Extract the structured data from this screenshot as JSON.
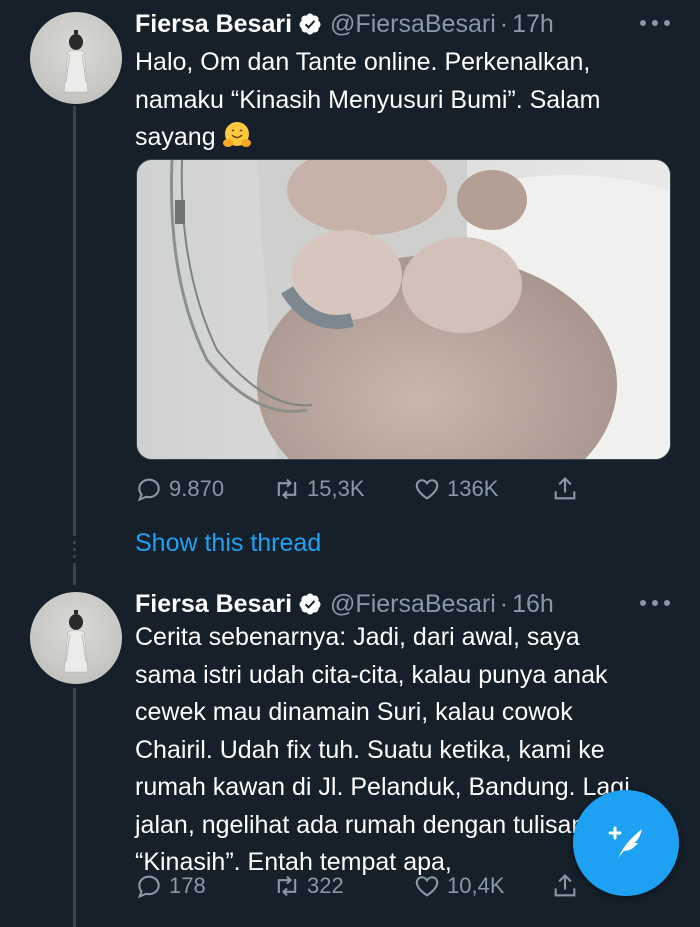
{
  "tweets": [
    {
      "author": "Fiersa Besari",
      "handle": "@FiersaBesari",
      "separator": "·",
      "time": "17h",
      "text_lines": [
        "Halo, Om dan Tante online. Perkenalkan,",
        "namaku “Kinasih Menyusuri Bumi”. Salam",
        "sayang"
      ],
      "emoji": "hugging-face-emoji",
      "has_media": true,
      "replies": "9.870",
      "retweets": "15,3K",
      "likes": "136K"
    },
    {
      "author": "Fiersa Besari",
      "handle": "@FiersaBesari",
      "separator": "·",
      "time": "16h",
      "text_lines": [
        "Cerita sebenarnya: Jadi, dari awal, saya",
        "sama istri udah cita-cita, kalau punya anak",
        "cewek mau dinamain Suri, kalau cowok",
        "Chairil. Udah fix tuh. Suatu ketika, kami ke",
        "rumah kawan di Jl. Pelanduk, Bandung. Lagi",
        "jalan, ngelihat ada rumah dengan tulisan",
        "“Kinasih”. Entah tempat apa,"
      ],
      "replies": "178",
      "retweets": "322",
      "likes": "10,4K"
    }
  ],
  "show_thread": "Show this thread",
  "colors": {
    "background": "#15202b",
    "accent": "#1da1f2",
    "muted": "#8899a6",
    "line": "#38444d"
  },
  "icons": [
    "verified-icon",
    "more-icon",
    "reply-icon",
    "retweet-icon",
    "like-icon",
    "share-icon",
    "compose-tweet-icon"
  ]
}
